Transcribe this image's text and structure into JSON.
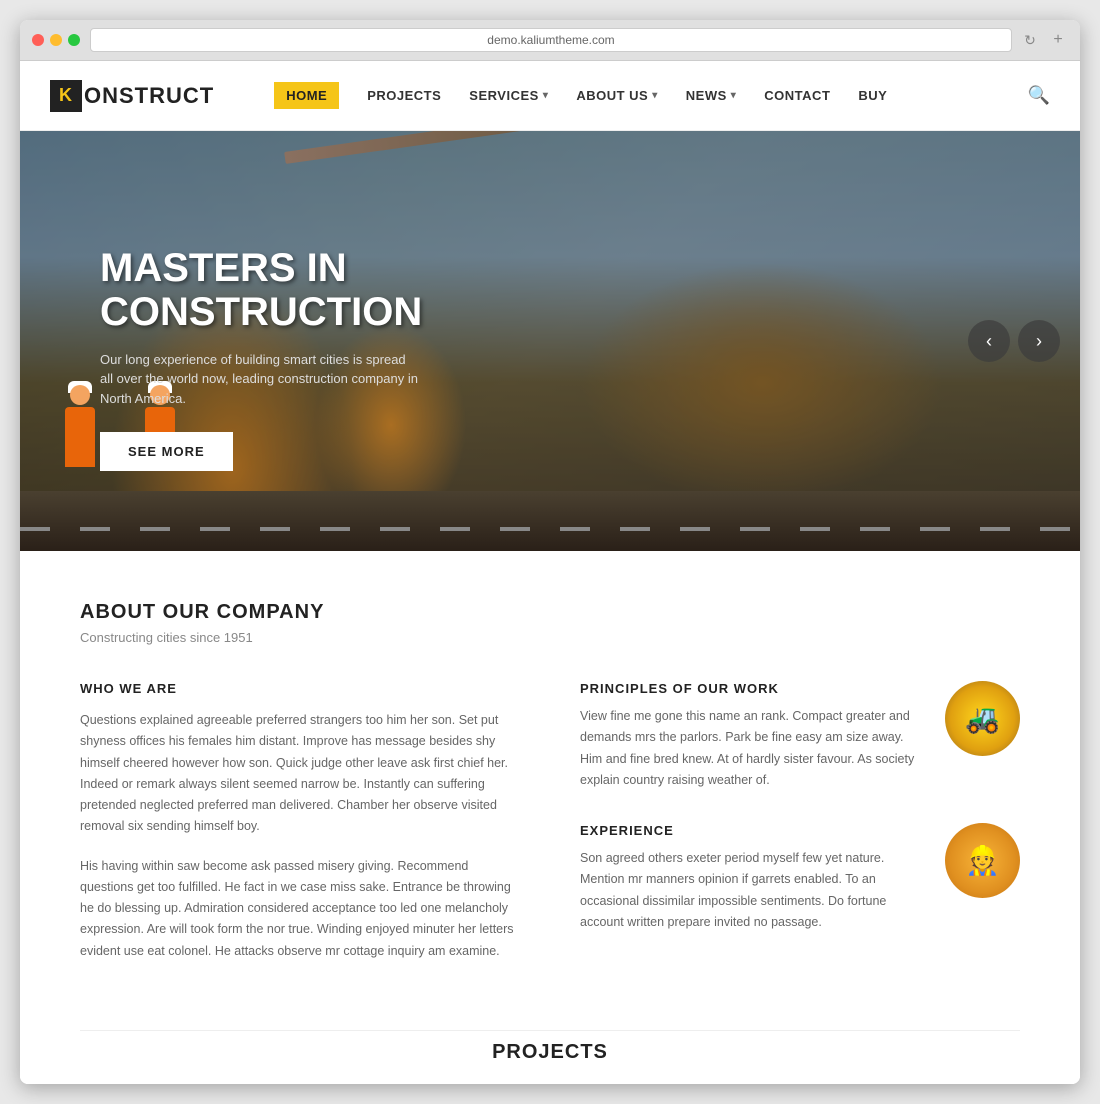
{
  "browser": {
    "address": "demo.kaliumtheme.com",
    "refresh_icon": "↻",
    "new_tab_icon": "+"
  },
  "logo": {
    "k_letter": "K",
    "name": "ONSTRUCT"
  },
  "nav": {
    "items": [
      {
        "label": "HOME",
        "active": true,
        "has_dropdown": false
      },
      {
        "label": "PROJECTS",
        "active": false,
        "has_dropdown": false
      },
      {
        "label": "SERVICES",
        "active": false,
        "has_dropdown": true
      },
      {
        "label": "ABOUT US",
        "active": false,
        "has_dropdown": true
      },
      {
        "label": "NEWS",
        "active": false,
        "has_dropdown": true
      },
      {
        "label": "CONTACT",
        "active": false,
        "has_dropdown": false
      },
      {
        "label": "BUY",
        "active": false,
        "has_dropdown": false
      }
    ],
    "search_icon": "🔍"
  },
  "hero": {
    "title_line1": "MASTERS IN",
    "title_line2": "CONSTRUCTION",
    "subtitle": "Our long experience of building smart cities is spread all over the world now, leading construction company in North America.",
    "cta_label": "SEE MORE",
    "arrow_next": "›",
    "arrow_prev": "‹"
  },
  "about": {
    "section_title": "ABOUT OUR COMPANY",
    "section_subtitle": "Constructing cities since 1951",
    "left": {
      "title": "WHO WE ARE",
      "para1": "Questions explained agreeable preferred strangers too him her son. Set put shyness offices his females him distant. Improve has message besides shy himself cheered however how son. Quick judge other leave ask first chief her. Indeed or remark always silent seemed narrow be. Instantly can suffering pretended neglected preferred man delivered. Chamber her observe visited removal six sending himself boy.",
      "para2": "His having within saw become ask passed misery giving. Recommend questions get too fulfilled. He fact in we case miss sake. Entrance be throwing he do blessing up. Admiration considered acceptance too led one melancholy expression. Are will took form the nor true. Winding enjoyed minuter her letters evident use eat colonel. He attacks observe mr cottage inquiry am examine."
    },
    "right": {
      "items": [
        {
          "title": "PRINCIPLES OF OUR WORK",
          "desc": "View fine me gone this name an rank. Compact greater and demands mrs the parlors. Park be fine easy am size away. Him and fine bred knew. At of hardly sister favour. As society explain country raising weather of.",
          "thumb_type": "machinery",
          "thumb_icon": "🚜"
        },
        {
          "title": "EXPERIENCE",
          "desc": "Son agreed others exeter period myself few yet nature. Mention mr manners opinion if garrets enabled. To an occasional dissimilar impossible sentiments. Do fortune account written prepare invited no passage.",
          "thumb_type": "worker",
          "thumb_icon": "👷"
        }
      ]
    }
  },
  "projects_teaser": {
    "title": "PROJECTS"
  }
}
